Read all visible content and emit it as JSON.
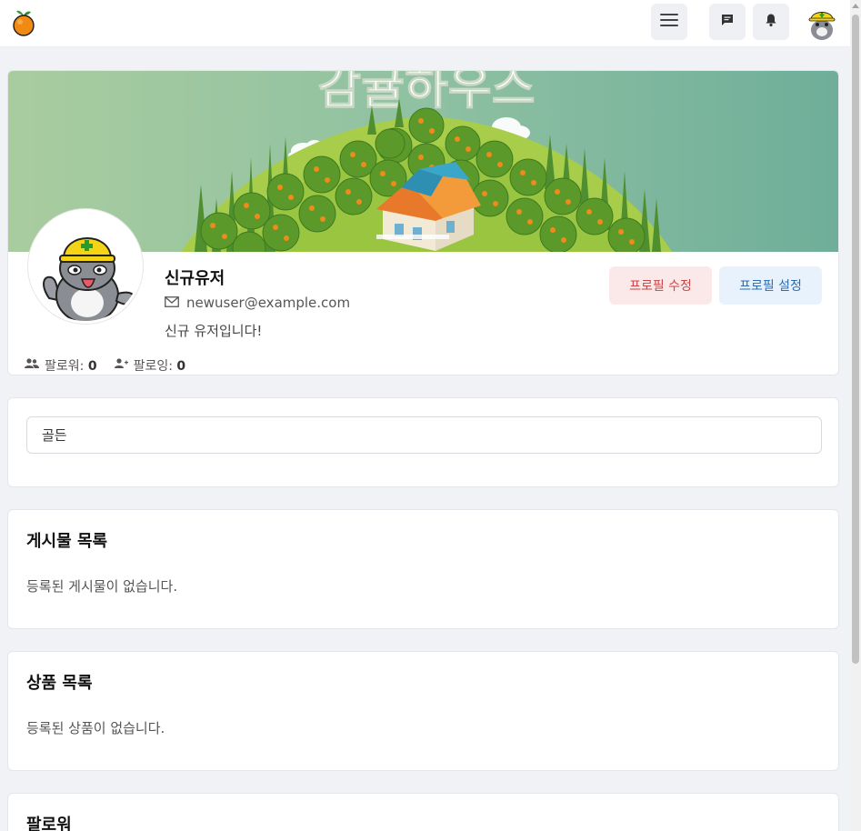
{
  "header": {
    "logo_icon": "orange-fruit-icon",
    "menu_icon": "hamburger-menu-icon",
    "chat_icon": "chat-message-icon",
    "notification_icon": "bell-icon",
    "user_avatar": "cat-helmet-avatar"
  },
  "banner": {
    "title": "감귤하우스",
    "image": "orange-orchard-house-illustration"
  },
  "profile": {
    "name": "신규유저",
    "email": "newuser@example.com",
    "bio": "신규 유저입니다!",
    "followers_label": "팔로워:",
    "followers_count": "0",
    "following_label": "팔로잉:",
    "following_count": "0",
    "edit_button": "프로필 수정",
    "settings_button": "프로필 설정"
  },
  "search": {
    "value": "골든"
  },
  "posts": {
    "title": "게시물 목록",
    "empty_text": "등록된 게시물이 없습니다."
  },
  "products": {
    "title": "상품 목록",
    "empty_text": "등록된 상품이 없습니다."
  },
  "followers": {
    "title": "팔로워"
  },
  "colors": {
    "page_bg": "#f0f2f6",
    "edit_button_bg": "#fbe9ea",
    "settings_button_bg": "#e8f2fd"
  }
}
